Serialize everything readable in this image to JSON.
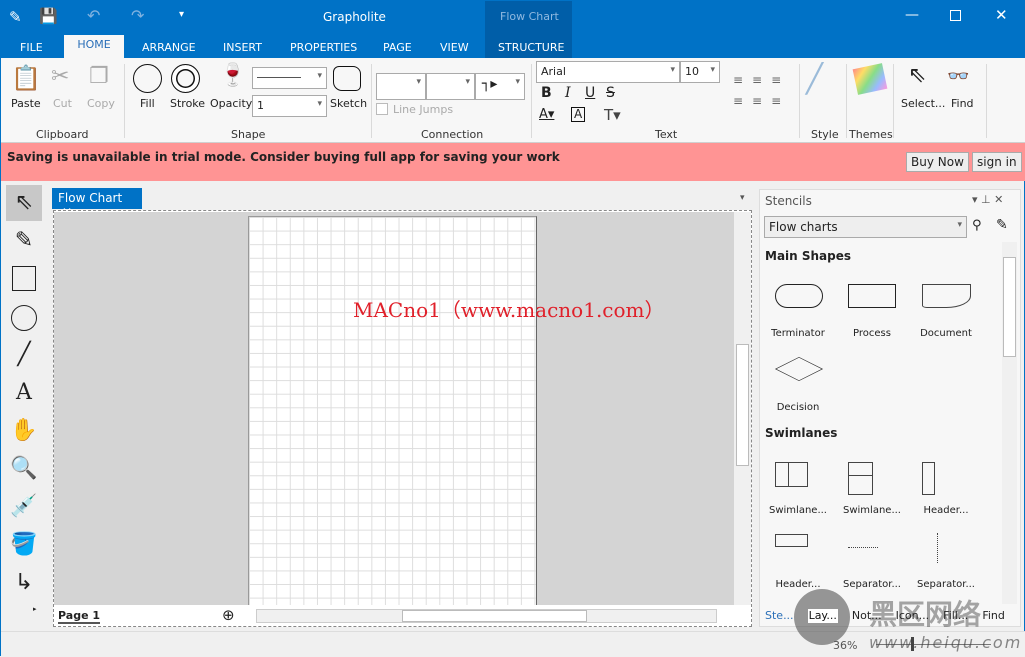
{
  "window": {
    "title": "Grapholite",
    "context_tab": "Flow Chart",
    "context_group": "STRUCTURE"
  },
  "ribbon_tabs": [
    "FILE",
    "HOME",
    "ARRANGE",
    "INSERT",
    "PROPERTIES",
    "PAGE",
    "VIEW"
  ],
  "ribbon": {
    "clipboard": {
      "label": "Clipboard",
      "paste": "Paste",
      "cut": "Cut",
      "copy": "Copy"
    },
    "shape": {
      "label": "Shape",
      "fill": "Fill",
      "stroke": "Stroke",
      "opacity": "Opacity",
      "line_width": "1",
      "sketch": "Sketch"
    },
    "connection": {
      "label": "Connection",
      "line_jumps": "Line Jumps"
    },
    "text": {
      "label": "Text",
      "font": "Arial",
      "size": "10",
      "bold": "B",
      "italic": "I",
      "underline": "U",
      "strike": "S"
    },
    "style": {
      "label": "Style"
    },
    "themes": {
      "label": "Themes"
    },
    "select": "Select...",
    "find": "Find"
  },
  "trial": {
    "message": "Saving is unavailable in trial mode. Consider buying full app for saving your work",
    "buy": "Buy Now",
    "sign_in": "sign in"
  },
  "document": {
    "tab": "Flow Chart",
    "page_tab": "Page 1",
    "watermark": "MACno1（www.macno1.com）"
  },
  "stencils": {
    "title": "Stencils",
    "library": "Flow charts",
    "sections": [
      {
        "title": "Main Shapes",
        "items": [
          "Terminator",
          "Process",
          "Document",
          "Decision"
        ]
      },
      {
        "title": "Swimlanes",
        "items": [
          "Swimlane...",
          "Swimlane...",
          "Header...",
          "Header...",
          "Separator...",
          "Separator..."
        ]
      }
    ],
    "bottom_tabs": [
      "Ste...",
      "Lay...",
      "Not...",
      "Icon...",
      "Fill...",
      "Find"
    ]
  },
  "status": {
    "zoom": "36%"
  },
  "overlay_watermark": {
    "text": "黑区网络",
    "url": "www.heiqu.com"
  }
}
